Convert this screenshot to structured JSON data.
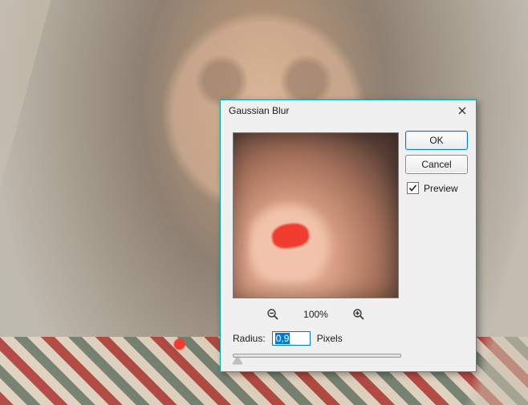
{
  "dialog": {
    "title": "Gaussian Blur",
    "ok_label": "OK",
    "cancel_label": "Cancel",
    "preview_label": "Preview",
    "preview_checked": true,
    "zoom_level": "100%",
    "radius_label": "Radius:",
    "radius_value": "0,9",
    "radius_unit": "Pixels",
    "slider_pos_pct": 3
  }
}
